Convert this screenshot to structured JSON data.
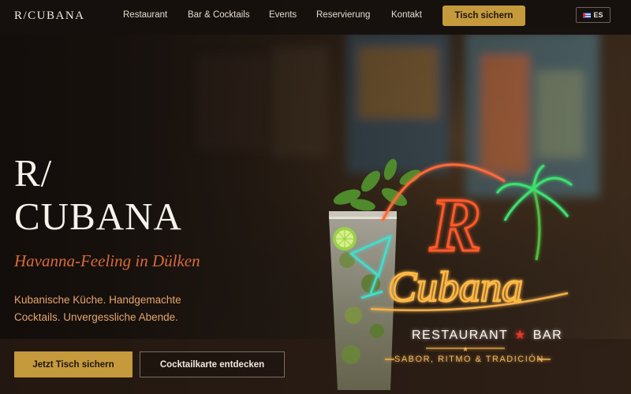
{
  "nav": {
    "logo": "R/CUBANA",
    "items": [
      "Restaurant",
      "Bar & Cocktails",
      "Events",
      "Reservierung",
      "Kontakt"
    ],
    "cta_label": "Tisch sichern",
    "lang_label": "ES"
  },
  "hero": {
    "title_line1": "R/",
    "title_line2": "CUBANA",
    "subtitle": "Havanna-Feeling in Dülken",
    "description": "Kubanische Küche. Handgemachte Cocktails. Unvergessliche Abende.",
    "primary_button": "Jetzt Tisch sichern",
    "secondary_button": "Cocktailkarte entdecken"
  },
  "sign": {
    "letter_r": "R",
    "word": "Cubana",
    "line": "RESTAURANT",
    "star": "★",
    "bar": "BAR",
    "divider_star": "★",
    "tagline": "SABOR, RITMO & TRADICIÓN"
  },
  "colors": {
    "accent": "#c49a3c",
    "subtitle": "#d96a3a",
    "description": "#e6a66d",
    "neon_red": "#e84a2a",
    "neon_green": "#2fd46a"
  }
}
